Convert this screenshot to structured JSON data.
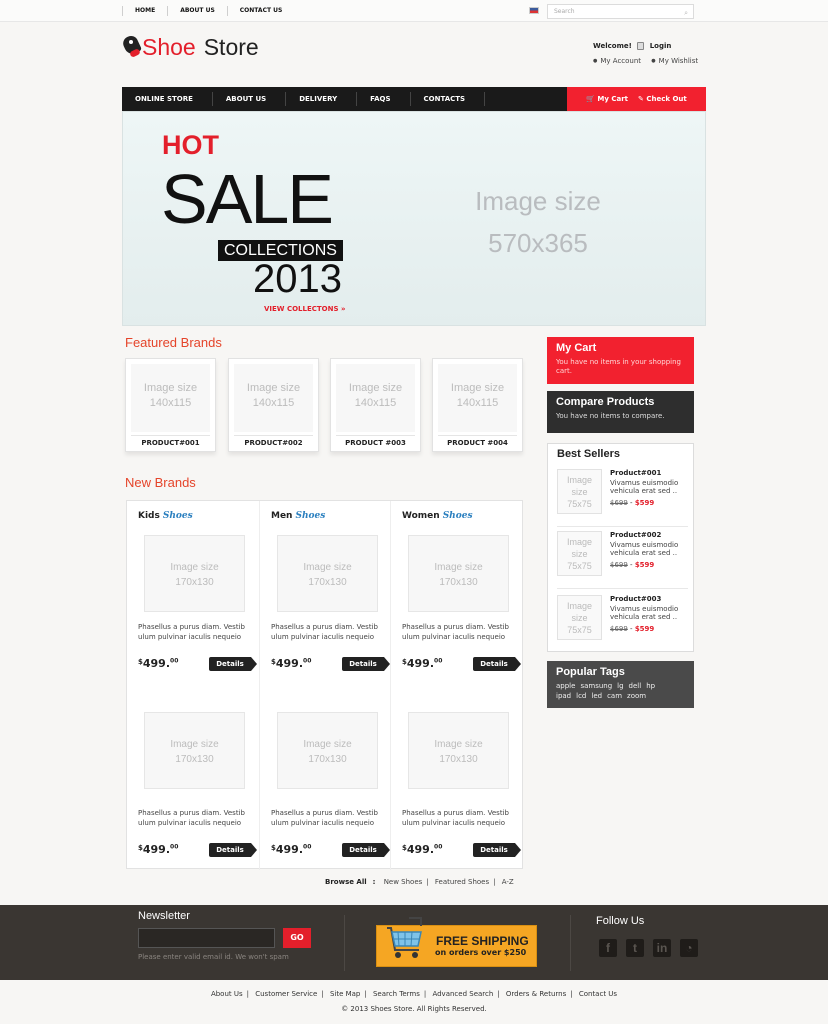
{
  "topbar": {
    "links": [
      "HOME",
      "ABOUT US",
      "CONTACT US"
    ],
    "search_placeholder": "Search"
  },
  "header": {
    "logo_red": "Shoe",
    "logo_dark": "Store",
    "welcome": "Welcome!",
    "login": "Login",
    "my_account": "My Account",
    "my_wishlist": "My Wishlist"
  },
  "nav": {
    "items": [
      "ONLINE STORE",
      "ABOUT US",
      "DELIVERY",
      "FAQS",
      "CONTACTS"
    ],
    "my_cart": "My Cart",
    "check_out": "Check Out"
  },
  "banner": {
    "hot": "HOT",
    "sale": "SALE",
    "collections": "COLLECTIONS",
    "year": "2013",
    "view": "VIEW COLLECTONS",
    "image_size_1": "Image size",
    "image_size_2": "570x365"
  },
  "featured": {
    "title": "Featured Brands",
    "items": [
      {
        "ph1": "Image size",
        "ph2": "140x115",
        "name": "PRODUCT#001"
      },
      {
        "ph1": "Image size",
        "ph2": "140x115",
        "name": "PRODUCT#002"
      },
      {
        "ph1": "Image size",
        "ph2": "140x115",
        "name": "PRODUCT #003"
      },
      {
        "ph1": "Image size",
        "ph2": "140x115",
        "name": "PRODUCT #004"
      }
    ]
  },
  "new_brands": {
    "title": "New Brands",
    "columns": [
      {
        "label": "Kids",
        "accent": "Shoes"
      },
      {
        "label": "Men",
        "accent": "Shoes"
      },
      {
        "label": "Women",
        "accent": "Shoes"
      }
    ],
    "placeholder_1": "Image size",
    "placeholder_2": "170x130",
    "desc_1": "Phasellus a purus diam. Vestib",
    "desc_2": "ulum pulvinar iaculis nequeio",
    "price_currency": "$",
    "price_main": "499.",
    "price_cents": "00",
    "details": "Details",
    "browse_label": "Browse All",
    "browse_colon": ":",
    "browse_links": [
      "New Shoes",
      "Featured Shoes",
      "A-Z"
    ]
  },
  "sidebar": {
    "cart_title": "My Cart",
    "cart_text": "You have no items in your shopping cart.",
    "compare_title": "Compare Products",
    "compare_text": "You have no items to compare.",
    "bestsellers_title": "Best Sellers",
    "bestsellers": [
      {
        "ph1": "Image",
        "ph2": "size",
        "ph3": "75x75",
        "name": "Product#001",
        "desc1": "Vivamus euismodio",
        "desc2": "vehicula erat sed ..",
        "old": "$699",
        "dash": " - ",
        "new": "$599"
      },
      {
        "ph1": "Image",
        "ph2": "size",
        "ph3": "75x75",
        "name": "Product#002",
        "desc1": "Vivamus euismodio",
        "desc2": "vehicula erat sed ..",
        "old": "$699",
        "dash": " - ",
        "new": "$599"
      },
      {
        "ph1": "Image",
        "ph2": "size",
        "ph3": "75x75",
        "name": "Product#003",
        "desc1": "Vivamus euismodio",
        "desc2": "vehicula erat sed ..",
        "old": "$699",
        "dash": " - ",
        "new": "$599"
      }
    ],
    "tags_title": "Popular Tags",
    "tags": [
      "apple",
      "samsung",
      "lg",
      "dell",
      "hp",
      "ipad",
      "lcd",
      "led",
      "cam",
      "zoom"
    ]
  },
  "footer": {
    "newsletter": "Newsletter",
    "go": "GO",
    "note": "Please enter valid email id. We won't spam",
    "ship1": "FREE SHIPPING",
    "ship2": "on orders over $250",
    "follow": "Follow Us",
    "links": [
      "About Us",
      "Customer Service",
      "Site Map",
      "Search Terms",
      "Advanced Search",
      "Orders & Returns",
      "Contact Us"
    ],
    "copyright": "© 2013 Shoes Store. All Rights Reserved."
  },
  "colors": {
    "accent_red": "#e31f2b",
    "nav_dark": "#1a1a1a",
    "footer": "#3a3632",
    "shipping": "#f5a623"
  }
}
